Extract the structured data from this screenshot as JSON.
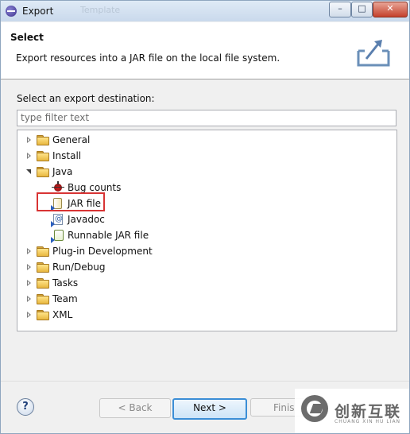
{
  "window": {
    "title": "Export",
    "ghost_title": "Template",
    "controls": {
      "minimize": "–",
      "maximize": "□",
      "close": "✕"
    }
  },
  "header": {
    "title": "Select",
    "description": "Export resources into a JAR file on the local file system.",
    "icon": "export-wizard-icon"
  },
  "destination": {
    "label": "Select an export destination:",
    "filter_placeholder": "type filter text",
    "filter_value": ""
  },
  "tree": {
    "items": [
      {
        "label": "General",
        "expanded": false,
        "icon": "folder-icon"
      },
      {
        "label": "Install",
        "expanded": false,
        "icon": "folder-icon"
      },
      {
        "label": "Java",
        "expanded": true,
        "icon": "folder-icon",
        "children": [
          {
            "label": "Bug counts",
            "icon": "bug-icon"
          },
          {
            "label": "JAR file",
            "icon": "jar-icon",
            "selected": true
          },
          {
            "label": "Javadoc",
            "icon": "javadoc-icon"
          },
          {
            "label": "Runnable JAR file",
            "icon": "runnable-jar-icon"
          }
        ]
      },
      {
        "label": "Plug-in Development",
        "expanded": false,
        "icon": "folder-icon"
      },
      {
        "label": "Run/Debug",
        "expanded": false,
        "icon": "folder-icon"
      },
      {
        "label": "Tasks",
        "expanded": false,
        "icon": "folder-icon"
      },
      {
        "label": "Team",
        "expanded": false,
        "icon": "folder-icon"
      },
      {
        "label": "XML",
        "expanded": false,
        "icon": "folder-icon"
      }
    ]
  },
  "footer": {
    "help": "?",
    "back": "< Back",
    "next": "Next >",
    "finish": "Finis"
  },
  "watermark": {
    "main": "创新互联",
    "sub": "CHUANG XIN HU LIAN"
  },
  "colors": {
    "highlight_border": "#d83434",
    "default_button_border": "#3b8ed6",
    "folder": "#e8b73f"
  }
}
